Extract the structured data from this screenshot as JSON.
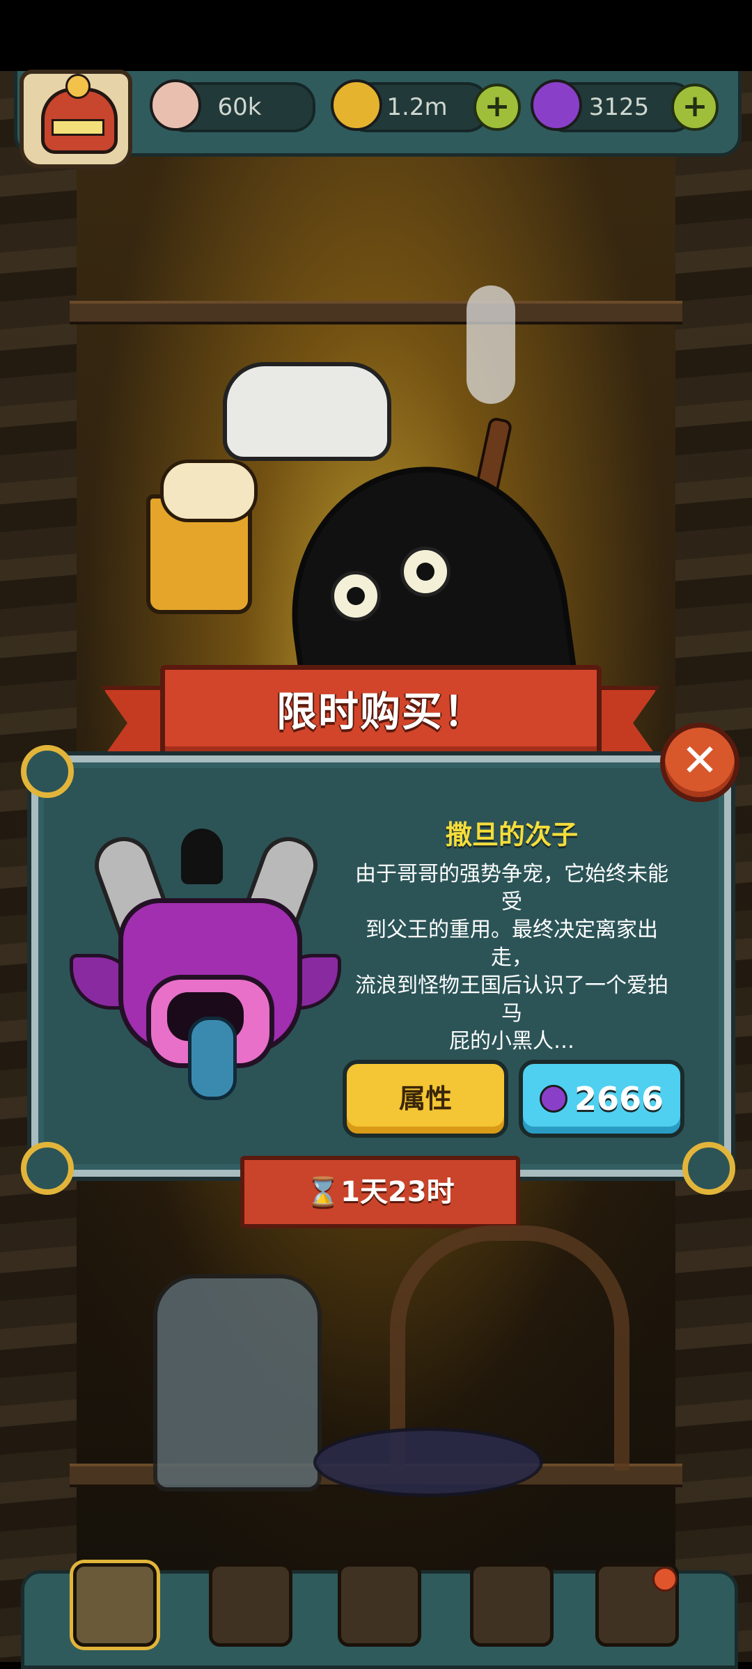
{
  "resources": {
    "eyeball": {
      "value": "60k",
      "icon": "eyeball-icon"
    },
    "coin": {
      "value": "1.2m",
      "icon": "coin-icon"
    },
    "potion": {
      "value": "3125",
      "icon": "potion-icon"
    }
  },
  "offer": {
    "banner_title": "限时购买！",
    "pet_name": "撒旦的次子",
    "description": "由于哥哥的强势争宠，它始终未能受\n到父王的重用。最终决定离家出走，\n流浪到怪物王国后认识了一个爱拍马\n屁的小黑人…",
    "attr_button": "属性",
    "price": "2666",
    "timer": "⌛1天23时",
    "close_symbol": "✕"
  },
  "nav": {
    "items": [
      "castle-icon",
      "monster-icon",
      "book-icon",
      "money-bag-icon",
      "grid-icon"
    ],
    "active_index": 0
  },
  "colors": {
    "accent_gold": "#f5dd3a",
    "panel": "#2c5457",
    "banner_red": "#d2452a",
    "price_blue": "#4fd0f0",
    "attr_yellow": "#f4c534"
  }
}
